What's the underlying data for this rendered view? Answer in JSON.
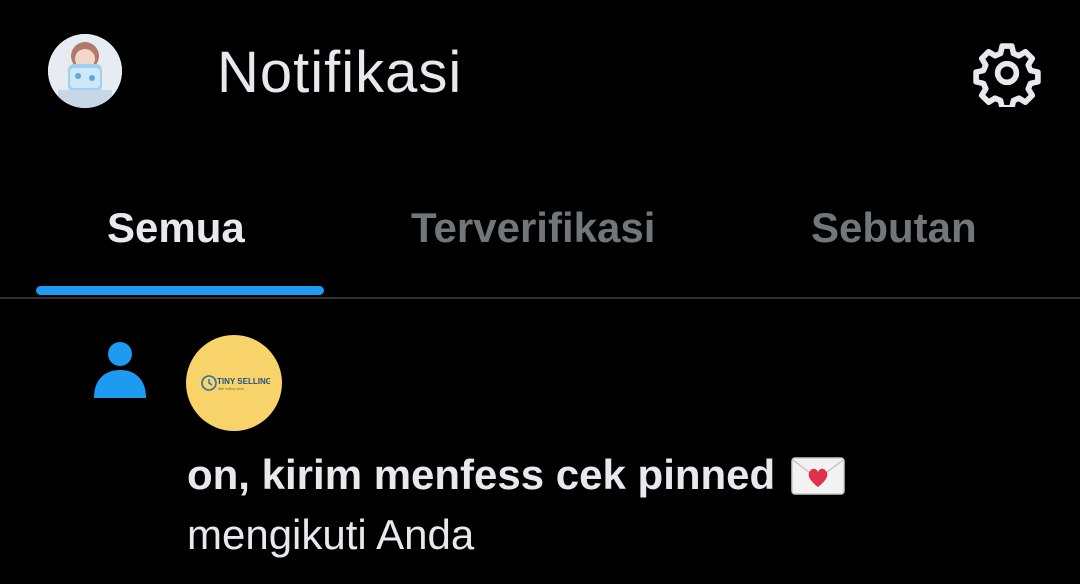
{
  "header": {
    "title": "Notifikasi",
    "avatar_icon": "user-avatar",
    "settings_icon": "gear-icon"
  },
  "tabs": [
    {
      "label": "Semua",
      "active": true
    },
    {
      "label": "Terverifikasi",
      "active": false
    },
    {
      "label": "Sebutan",
      "active": false
    }
  ],
  "notification": {
    "type_icon": "person-follow-icon",
    "sender_name": "on, kirim menfess cek pinned",
    "sender_emoji": "love-letter-icon",
    "action": "mengikuti Anda",
    "avatar_logo": {
      "line1": "TINY SELLING",
      "line2": "little selling store"
    }
  },
  "colors": {
    "background": "#000000",
    "text_primary": "#e7e9ea",
    "text_secondary": "#71767b",
    "accent": "#1d9bf0",
    "divider": "#2f3336",
    "sender_avatar_bg": "#f8d36a"
  }
}
